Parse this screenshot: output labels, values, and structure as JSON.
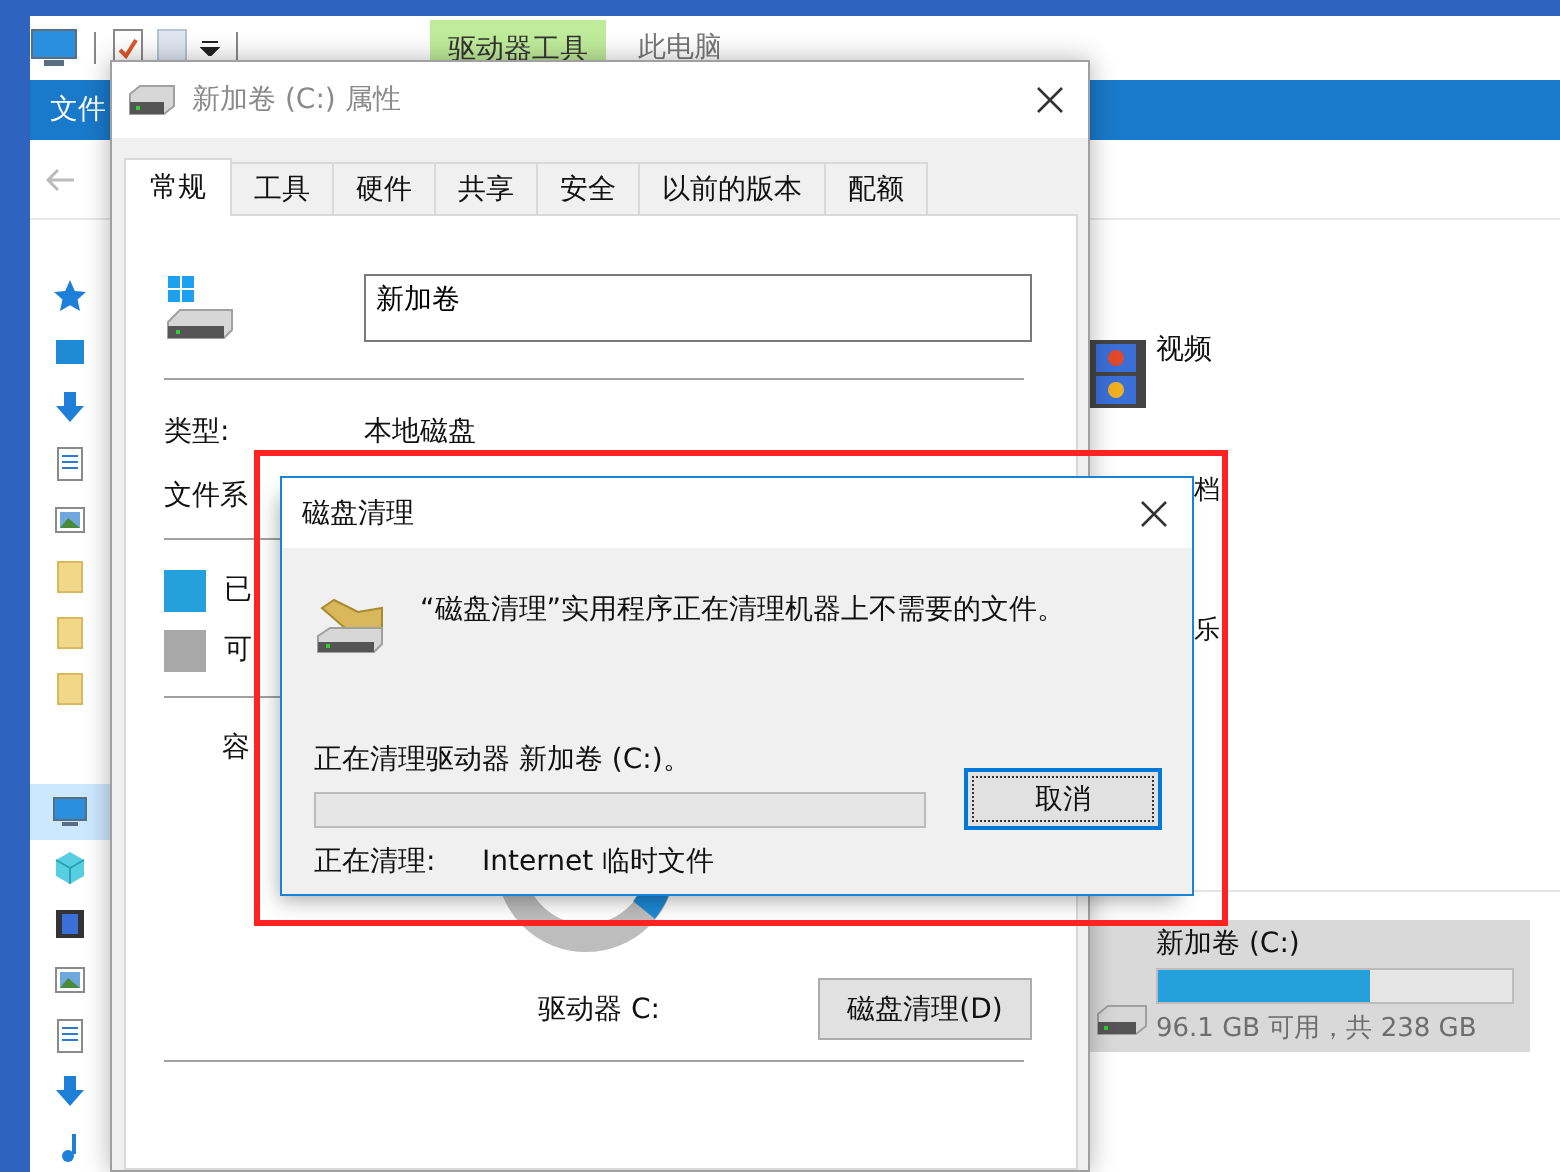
{
  "explorer": {
    "context_tab": "驱动器工具",
    "title": "此电脑",
    "file_tab": "文件",
    "nav_items": [
      {
        "kind": "quick-access",
        "selected": false
      },
      {
        "kind": "desktop",
        "selected": false
      },
      {
        "kind": "downloads",
        "selected": false
      },
      {
        "kind": "documents",
        "selected": false
      },
      {
        "kind": "pictures",
        "selected": false
      },
      {
        "kind": "folder",
        "selected": false
      },
      {
        "kind": "folder",
        "selected": false
      },
      {
        "kind": "folder",
        "selected": false
      },
      {
        "kind": "this-pc",
        "selected": true
      },
      {
        "kind": "objects",
        "selected": false
      },
      {
        "kind": "videos",
        "selected": false
      },
      {
        "kind": "pictures",
        "selected": false
      },
      {
        "kind": "documents",
        "selected": false
      },
      {
        "kind": "downloads",
        "selected": false
      },
      {
        "kind": "music",
        "selected": false
      }
    ],
    "content_items": [
      {
        "kind": "videos",
        "label": "视频"
      },
      {
        "kind": "documents",
        "label": "档"
      },
      {
        "kind": "music",
        "label": "乐"
      }
    ],
    "drive": {
      "name": "新加卷 (C:)",
      "level": 0.6,
      "space": "96.1 GB 可用，共 238 GB",
      "selected": true
    }
  },
  "properties": {
    "title": "新加卷 (C:) 属性",
    "active": false,
    "tabs": [
      {
        "label": "常规",
        "selected": true
      },
      {
        "label": "工具",
        "selected": false
      },
      {
        "label": "硬件",
        "selected": false
      },
      {
        "label": "共享",
        "selected": false
      },
      {
        "label": "安全",
        "selected": false
      },
      {
        "label": "以前的版本",
        "selected": false
      },
      {
        "label": "配额",
        "selected": false
      }
    ],
    "volume_name": "新加卷",
    "type_label": "类型:",
    "type_value": "本地磁盘",
    "fs_label": "文件系",
    "used_label": "已",
    "free_label": "可",
    "capacity_label": "容",
    "drive_label": "驱动器 C:",
    "cleanup_button": "磁盘清理(D)"
  },
  "cleanup": {
    "title": "磁盘清理",
    "message": "“磁盘清理”实用程序正在清理机器上不需要的文件。",
    "drive_status": "正在清理驱动器 新加卷 (C:)。",
    "level": 0,
    "cancel": {
      "label": "取消",
      "focused": true
    },
    "current_label": "正在清理:",
    "current_item": "Internet 临时文件"
  }
}
